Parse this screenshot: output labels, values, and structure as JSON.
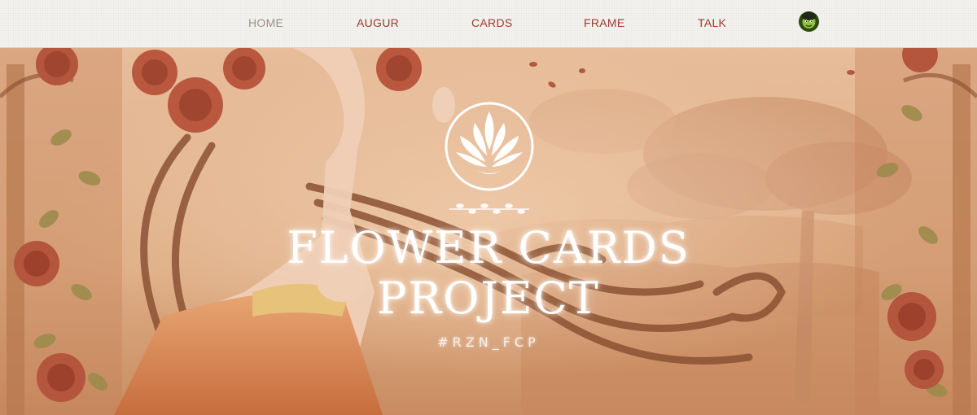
{
  "nav": {
    "items": [
      {
        "label": "HOME"
      },
      {
        "label": "AUGUR"
      },
      {
        "label": "CARDS"
      },
      {
        "label": "FRAME"
      },
      {
        "label": "TALK"
      }
    ],
    "active": "HOME",
    "avatar_icon": "user-avatar-icon"
  },
  "hero": {
    "logo_icon": "lotus-icon",
    "title_line1": "FLOWER CARDS",
    "title_line2": "PROJECT",
    "hashtag": "#RZN_FCP"
  },
  "colors": {
    "nav_link": "#9b3b2d",
    "nav_active": "#9a928c",
    "hero_bg": "#d9a983",
    "title": "#ffffff"
  }
}
